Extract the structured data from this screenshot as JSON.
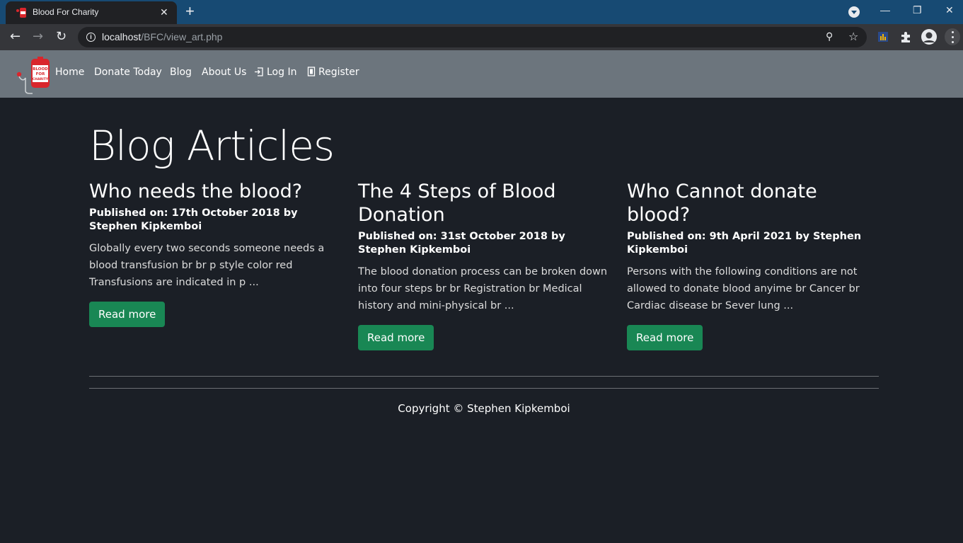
{
  "browser": {
    "tab_title": "Blood For Charity",
    "tab_close": "✕",
    "new_tab": "+",
    "url_host": "localhost",
    "url_path": "/BFC/view_art.php",
    "window_controls": {
      "minimize": "—",
      "restore": "❐",
      "close": "✕"
    }
  },
  "site": {
    "brand_logo_text": [
      "BLOOD",
      "FOR",
      "CHARITY"
    ],
    "nav": {
      "home": "Home",
      "donate": "Donate Today",
      "blog": "Blog",
      "about": "About Us",
      "login": "Log In",
      "register": "Register"
    }
  },
  "main": {
    "heading": "Blog Articles",
    "articles": [
      {
        "title": "Who needs the blood?",
        "meta": "Published on: 17th October 2018 by Stephen Kipkemboi",
        "excerpt": "Globally every two seconds someone needs a blood transfusion br br p style color red Transfusions are indicated in p ...",
        "button": "Read more"
      },
      {
        "title": "The 4 Steps of Blood Donation",
        "meta": "Published on: 31st October 2018 by Stephen Kipkemboi",
        "excerpt": "The blood donation process can be broken down into four steps br br Registration br Medical history and mini-physical br ...",
        "button": "Read more"
      },
      {
        "title": "Who Cannot donate blood?",
        "meta": "Published on: 9th April 2021 by Stephen Kipkemboi",
        "excerpt": "Persons with the following conditions are not allowed to donate blood anyime br Cancer br Cardiac disease br Sever lung ...",
        "button": "Read more"
      }
    ]
  },
  "footer": {
    "copyright": "Copyright © Stephen Kipkemboi"
  },
  "colors": {
    "tabbar": "#174a73",
    "navbar": "#6c757d",
    "page_bg": "#1b1f26",
    "button": "#198754"
  },
  "icons": [
    "back-icon",
    "forward-icon",
    "reload-icon",
    "info-icon",
    "key-icon",
    "star-icon",
    "extension-icon",
    "puzzle-icon",
    "avatar",
    "menu-icon",
    "login-icon",
    "register-icon"
  ]
}
